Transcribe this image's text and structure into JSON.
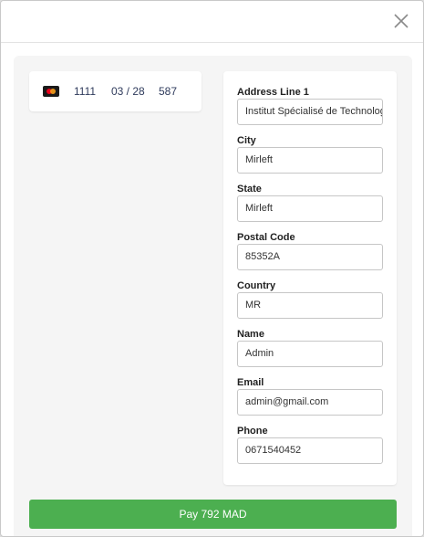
{
  "card": {
    "brand_icon": "mastercard-icon",
    "number": "1111",
    "expiry": "03 / 28",
    "cvc": "587"
  },
  "address": {
    "line1_label": "Address Line 1",
    "line1_value": "Institut Spécialisé de Technologie",
    "city_label": "City",
    "city_value": "Mirleft",
    "state_label": "State",
    "state_value": "Mirleft",
    "postal_label": "Postal Code",
    "postal_value": "85352A",
    "country_label": "Country",
    "country_value": "MR",
    "name_label": "Name",
    "name_value": "Admin",
    "email_label": "Email",
    "email_value": "admin@gmail.com",
    "phone_label": "Phone",
    "phone_value": "0671540452"
  },
  "pay_button": {
    "label": "Pay 792 MAD",
    "color": "#4caf50"
  },
  "colors": {
    "panel_bg": "#f5f5f5",
    "card_text": "#2f3b5c"
  }
}
